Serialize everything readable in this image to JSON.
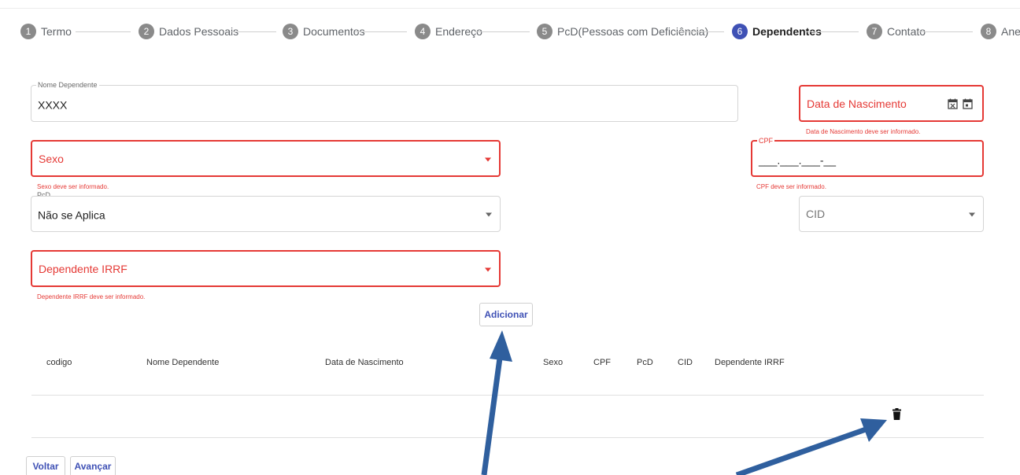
{
  "stepper": {
    "steps": [
      {
        "number": "1",
        "label": "Termo"
      },
      {
        "number": "2",
        "label": "Dados Pessoais"
      },
      {
        "number": "3",
        "label": "Documentos"
      },
      {
        "number": "4",
        "label": "Endereço"
      },
      {
        "number": "5",
        "label": "PcD(Pessoas com Deficiência)"
      },
      {
        "number": "6",
        "label": "Dependentes"
      },
      {
        "number": "7",
        "label": "Contato"
      },
      {
        "number": "8",
        "label": "Anexo"
      }
    ],
    "active_step": "6"
  },
  "form": {
    "nome_dependente": {
      "label": "Nome Dependente",
      "value": "XXXX"
    },
    "data_nascimento": {
      "placeholder": "Data de Nascimento",
      "error": "Data de Nascimento deve ser informado.",
      "icons": [
        "calendar-clear-icon",
        "calendar-icon"
      ]
    },
    "sexo": {
      "placeholder": "Sexo",
      "error": "Sexo deve ser informado."
    },
    "cpf": {
      "label": "CPF",
      "value": "___.___.___-__",
      "error": "CPF deve ser informado."
    },
    "pcd": {
      "label": "PcD",
      "value": "Não se Aplica"
    },
    "cid": {
      "placeholder": "CID"
    },
    "dependente_irrf": {
      "placeholder": "Dependente IRRF",
      "error": "Dependente IRRF deve ser informado."
    }
  },
  "buttons": {
    "adicionar": "Adicionar",
    "voltar": "Voltar",
    "avancar": "Avançar"
  },
  "table": {
    "columns": [
      "codigo",
      "Nome Dependente",
      "Data de Nascimento",
      "Sexo",
      "CPF",
      "PcD",
      "CID",
      "Dependente IRRF"
    ],
    "rows": [
      {
        "codigo": "",
        "nome": "",
        "nascimento": "",
        "sexo": "",
        "cpf": "",
        "pcd": "",
        "cid": "",
        "irrf": "",
        "action_icon": "trash-icon"
      }
    ]
  },
  "colors": {
    "primary": "#3f51b5",
    "error": "#e53935",
    "annotation_arrow": "#2f5f9e"
  }
}
